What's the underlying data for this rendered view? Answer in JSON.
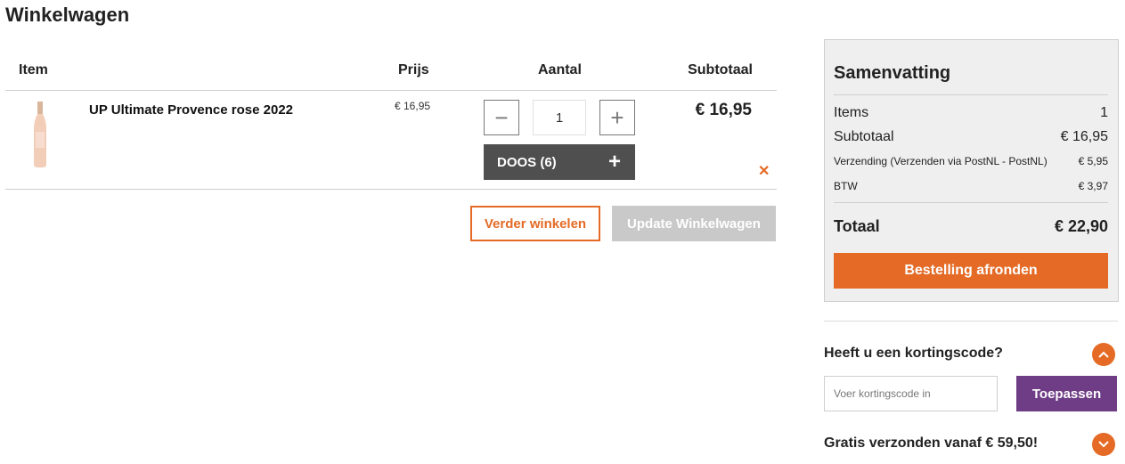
{
  "page": {
    "title": "Winkelwagen"
  },
  "cart": {
    "headers": {
      "item": "Item",
      "price": "Prijs",
      "quantity": "Aantal",
      "subtotal": "Subtotaal"
    },
    "items": [
      {
        "name": "UP Ultimate Provence rose 2022",
        "price": "€ 16,95",
        "quantity": "1",
        "box_label": "DOOS (6)",
        "subtotal": "€ 16,95"
      }
    ],
    "continue_label": "Verder winkelen",
    "update_label": "Update Winkelwagen"
  },
  "summary": {
    "title": "Samenvatting",
    "items_label": "Items",
    "items_value": "1",
    "subtotal_label": "Subtotaal",
    "subtotal_value": "€ 16,95",
    "shipping_label": "Verzending (Verzenden via PostNL - PostNL)",
    "shipping_value": "€ 5,95",
    "tax_label": "BTW",
    "tax_value": "€ 3,97",
    "total_label": "Totaal",
    "total_value": "€ 22,90",
    "checkout_label": "Bestelling afronden"
  },
  "coupon": {
    "title": "Heeft u een kortingscode?",
    "placeholder": "Voer kortingscode in",
    "apply_label": "Toepassen"
  },
  "shipping_info": {
    "title": "Gratis verzonden vanaf € 59,50!"
  },
  "colors": {
    "accent": "#e46a25",
    "apply": "#6f3d86",
    "dark_button": "#4f4f4f",
    "disabled": "#c9c9c9"
  }
}
